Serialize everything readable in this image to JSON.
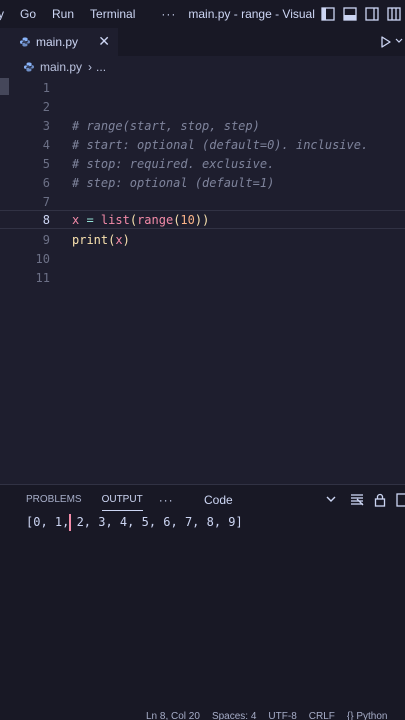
{
  "menubar": {
    "items": [
      {
        "label": "y"
      },
      {
        "label": "Go"
      },
      {
        "label": "Run"
      },
      {
        "label": "Terminal"
      }
    ],
    "more": "···",
    "window_title": "main.py - range - Visual Studio..."
  },
  "tab": {
    "label": "main.py",
    "close": "✕"
  },
  "breadcrumb": {
    "file": "main.py",
    "separator": "›",
    "symbol": "..."
  },
  "editor": {
    "active_line": 8,
    "lines": [
      {
        "n": "1",
        "code": ""
      },
      {
        "n": "2",
        "code": ""
      },
      {
        "n": "3",
        "code": "# range(start, stop, step)"
      },
      {
        "n": "4",
        "code": "# start: optional (default=0). inclusive."
      },
      {
        "n": "5",
        "code": "# stop: required. exclusive."
      },
      {
        "n": "6",
        "code": "# step: optional (default=1)"
      },
      {
        "n": "7",
        "code": ""
      },
      {
        "n": "8",
        "tokens": [
          "x",
          " = ",
          "list",
          "(",
          "range",
          "(",
          "10",
          ")",
          ")"
        ]
      },
      {
        "n": "9",
        "tokens": [
          "print",
          "(",
          "x",
          ")"
        ]
      },
      {
        "n": "10",
        "code": ""
      },
      {
        "n": "11",
        "code": ""
      }
    ]
  },
  "panel": {
    "tabs": [
      {
        "label": "PROBLEMS",
        "active": false
      },
      {
        "label": "OUTPUT",
        "active": true
      }
    ],
    "more": "···",
    "channel": "Code",
    "output": "[0, 1, 2, 3, 4, 5, 6, 7, 8, 9]"
  },
  "statusbar": {
    "items": [
      "Ln 8, Col 20",
      "Spaces: 4",
      "UTF-8",
      "CRLF",
      "{} Python"
    ]
  },
  "colors": {
    "background": "#1e1e2e",
    "chrome": "#181825",
    "comment": "#7f849c",
    "accent_pink": "#f38ba8",
    "number": "#fab387",
    "python_icon": "#89b4fa"
  }
}
